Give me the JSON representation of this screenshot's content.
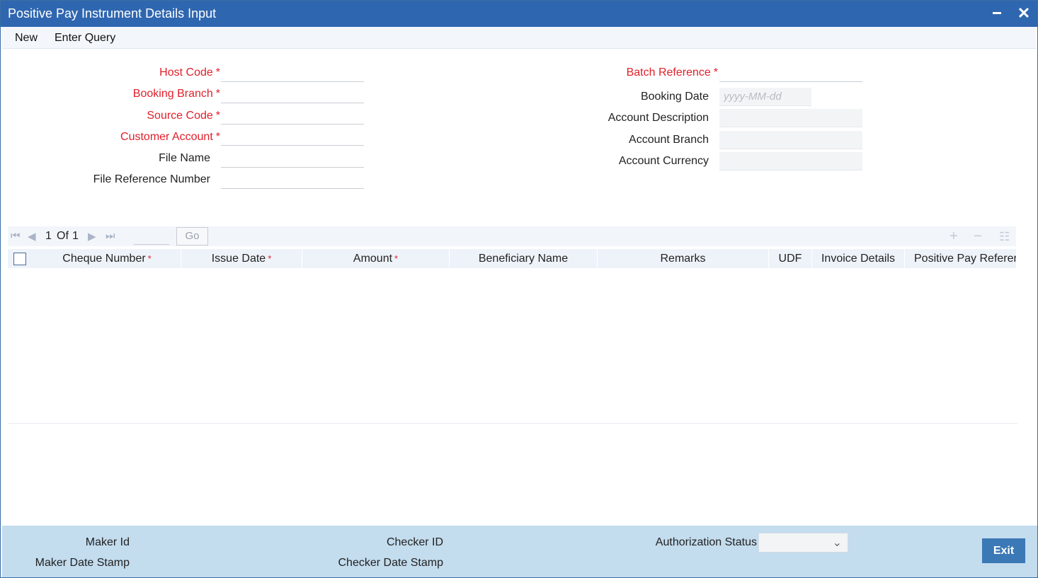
{
  "window": {
    "title": "Positive Pay Instrument Details Input"
  },
  "menu": {
    "new": "New",
    "enter_query": "Enter Query"
  },
  "form": {
    "left": {
      "host_code": "Host Code",
      "booking_branch": "Booking Branch",
      "source_code": "Source Code",
      "customer_account": "Customer Account",
      "file_name": "File Name",
      "file_reference_number": "File Reference Number"
    },
    "right": {
      "batch_reference": "Batch Reference",
      "booking_date": "Booking Date",
      "booking_date_placeholder": "yyyy-MM-dd",
      "account_description": "Account Description",
      "account_branch": "Account Branch",
      "account_currency": "Account Currency"
    },
    "required_mark": "*"
  },
  "grid": {
    "pager": {
      "current": "1",
      "of": "Of",
      "total": "1",
      "go": "Go"
    },
    "columns": [
      "Cheque Number",
      "Issue Date",
      "Amount",
      "Beneficiary Name",
      "Remarks",
      "UDF",
      "Invoice Details",
      "Positive Pay Referer"
    ],
    "required_mark": "*"
  },
  "footer": {
    "maker_id": "Maker Id",
    "maker_date_stamp": "Maker Date Stamp",
    "checker_id": "Checker ID",
    "checker_date_stamp": "Checker Date Stamp",
    "authorization_status": "Authorization Status",
    "exit": "Exit"
  },
  "colors": {
    "titlebar": "#2f66b0",
    "required": "#e0202a",
    "footer": "#c3dcee",
    "exit_button": "#3b78b6"
  },
  "icons": [
    "minimize-icon",
    "close-icon",
    "first-page-icon",
    "prev-page-icon",
    "next-page-icon",
    "last-page-icon",
    "add-row-icon",
    "delete-row-icon",
    "columns-icon",
    "chevron-down-icon"
  ]
}
